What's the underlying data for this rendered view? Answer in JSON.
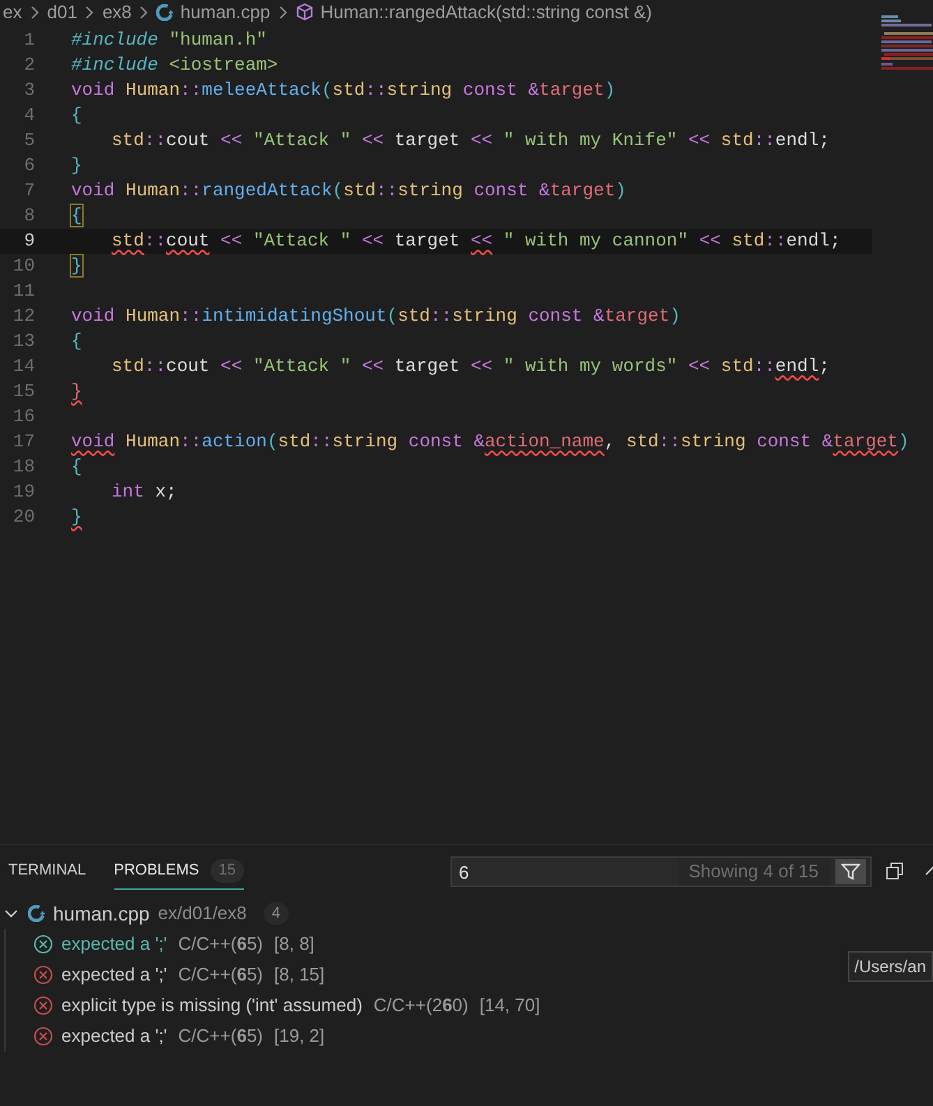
{
  "breadcrumb": [
    "ex",
    "d01",
    "ex8",
    "human.cpp",
    "Human::rangedAttack(std::string const &)"
  ],
  "code_lines": [
    {
      "number": "1",
      "active": false,
      "indented": false,
      "tokens": [
        {
          "kind": "directive",
          "text": "#include",
          "error": false
        },
        {
          "kind": "str",
          "text": " \"human.h\"",
          "error": false
        }
      ]
    },
    {
      "number": "2",
      "active": false,
      "indented": false,
      "tokens": [
        {
          "kind": "directive",
          "text": "#include",
          "error": false
        },
        {
          "kind": "str",
          "text": " <iostream>",
          "error": false
        }
      ]
    },
    {
      "number": "3",
      "active": false,
      "indented": false,
      "tokens": [
        {
          "kind": "kw",
          "text": "void ",
          "error": false
        },
        {
          "kind": "type",
          "text": "Human",
          "error": false
        },
        {
          "kind": "op",
          "text": "::",
          "error": false
        },
        {
          "kind": "fn",
          "text": "meleeAttack",
          "error": false
        },
        {
          "kind": "brace",
          "text": "(",
          "error": false
        },
        {
          "kind": "type",
          "text": "std",
          "error": false
        },
        {
          "kind": "op",
          "text": "::",
          "error": false
        },
        {
          "kind": "type",
          "text": "string ",
          "error": false
        },
        {
          "kind": "kw",
          "text": "const &",
          "error": false
        },
        {
          "kind": "param",
          "text": "target",
          "error": false
        },
        {
          "kind": "brace",
          "text": ")",
          "error": false
        }
      ]
    },
    {
      "number": "4",
      "active": false,
      "indented": false,
      "tokens": [
        {
          "kind": "brace",
          "text": "{",
          "error": false
        }
      ]
    },
    {
      "number": "5",
      "active": false,
      "indented": true,
      "tokens": [
        {
          "kind": "type",
          "text": "std",
          "error": false
        },
        {
          "kind": "op",
          "text": "::",
          "error": false
        },
        {
          "kind": "plain",
          "text": "cout ",
          "error": false
        },
        {
          "kind": "op",
          "text": "<< ",
          "error": false
        },
        {
          "kind": "str",
          "text": "\"Attack \" ",
          "error": false
        },
        {
          "kind": "op",
          "text": "<< ",
          "error": false
        },
        {
          "kind": "plain",
          "text": "target ",
          "error": false
        },
        {
          "kind": "op",
          "text": "<< ",
          "error": false
        },
        {
          "kind": "str",
          "text": "\" with my Knife\" ",
          "error": false
        },
        {
          "kind": "op",
          "text": "<< ",
          "error": false
        },
        {
          "kind": "type",
          "text": "std",
          "error": false
        },
        {
          "kind": "op",
          "text": "::",
          "error": false
        },
        {
          "kind": "plain",
          "text": "endl;",
          "error": false
        }
      ]
    },
    {
      "number": "6",
      "active": false,
      "indented": false,
      "tokens": [
        {
          "kind": "brace",
          "text": "}",
          "error": false
        }
      ]
    },
    {
      "number": "7",
      "active": false,
      "indented": false,
      "tokens": [
        {
          "kind": "kw",
          "text": "void ",
          "error": false
        },
        {
          "kind": "type",
          "text": "Human",
          "error": false
        },
        {
          "kind": "op",
          "text": "::",
          "error": false
        },
        {
          "kind": "fn",
          "text": "rangedAttack",
          "error": false
        },
        {
          "kind": "brace",
          "text": "(",
          "error": false
        },
        {
          "kind": "type",
          "text": "std",
          "error": false
        },
        {
          "kind": "op",
          "text": "::",
          "error": false
        },
        {
          "kind": "type",
          "text": "string ",
          "error": false
        },
        {
          "kind": "kw",
          "text": "const &",
          "error": false
        },
        {
          "kind": "param",
          "text": "target",
          "error": false
        },
        {
          "kind": "brace",
          "text": ")",
          "error": false
        }
      ]
    },
    {
      "number": "8",
      "active": false,
      "indented": false,
      "tokens": [
        {
          "kind": "match",
          "text": "{",
          "error": false
        }
      ]
    },
    {
      "number": "9",
      "active": true,
      "indented": true,
      "tokens": [
        {
          "kind": "type",
          "text": "std",
          "error": true
        },
        {
          "kind": "op",
          "text": "::",
          "error": false
        },
        {
          "kind": "plain",
          "text": "cout",
          "error": true
        },
        {
          "kind": "op",
          "text": " << ",
          "error": false
        },
        {
          "kind": "str",
          "text": "\"Attack \" ",
          "error": false
        },
        {
          "kind": "op",
          "text": "<< ",
          "error": false
        },
        {
          "kind": "plain",
          "text": "target ",
          "error": false
        },
        {
          "kind": "op",
          "text": "<<",
          "error": true
        },
        {
          "kind": "str",
          "text": " \" with my cannon\" ",
          "error": false
        },
        {
          "kind": "op",
          "text": "<< ",
          "error": false
        },
        {
          "kind": "type",
          "text": "std",
          "error": false
        },
        {
          "kind": "op",
          "text": "::",
          "error": false
        },
        {
          "kind": "plain",
          "text": "endl;",
          "error": false
        }
      ]
    },
    {
      "number": "10",
      "active": false,
      "indented": false,
      "tokens": [
        {
          "kind": "match",
          "text": "}",
          "error": false
        }
      ]
    },
    {
      "number": "11",
      "active": false
    },
    {
      "number": "12",
      "active": false,
      "indented": false,
      "tokens": [
        {
          "kind": "kw",
          "text": "void ",
          "error": false
        },
        {
          "kind": "type",
          "text": "Human",
          "error": false
        },
        {
          "kind": "op",
          "text": "::",
          "error": false
        },
        {
          "kind": "fn",
          "text": "intimidatingShout",
          "error": false
        },
        {
          "kind": "brace",
          "text": "(",
          "error": false
        },
        {
          "kind": "type",
          "text": "std",
          "error": false
        },
        {
          "kind": "op",
          "text": "::",
          "error": false
        },
        {
          "kind": "type",
          "text": "string ",
          "error": false
        },
        {
          "kind": "kw",
          "text": "const &",
          "error": false
        },
        {
          "kind": "param",
          "text": "target",
          "error": false
        },
        {
          "kind": "brace",
          "text": ")",
          "error": false
        }
      ]
    },
    {
      "number": "13",
      "active": false,
      "indented": false,
      "tokens": [
        {
          "kind": "brace",
          "text": "{",
          "error": false
        }
      ]
    },
    {
      "number": "14",
      "active": false,
      "indented": true,
      "tokens": [
        {
          "kind": "type",
          "text": "std",
          "error": false
        },
        {
          "kind": "op",
          "text": "::",
          "error": false
        },
        {
          "kind": "plain",
          "text": "cout ",
          "error": false
        },
        {
          "kind": "op",
          "text": "<< ",
          "error": false
        },
        {
          "kind": "str",
          "text": "\"Attack \" ",
          "error": false
        },
        {
          "kind": "op",
          "text": "<< ",
          "error": false
        },
        {
          "kind": "plain",
          "text": "target ",
          "error": false
        },
        {
          "kind": "op",
          "text": "<< ",
          "error": false
        },
        {
          "kind": "str",
          "text": "\" with my words\" ",
          "error": false
        },
        {
          "kind": "op",
          "text": "<< ",
          "error": false
        },
        {
          "kind": "type",
          "text": "std",
          "error": false
        },
        {
          "kind": "op",
          "text": "::",
          "error": false
        },
        {
          "kind": "plain",
          "text": "endl",
          "error": true
        },
        {
          "kind": "plain",
          "text": ";",
          "error": false
        }
      ]
    },
    {
      "number": "15",
      "active": false,
      "indented": false,
      "tokens": [
        {
          "kind": "param",
          "text": "}",
          "error": true
        }
      ]
    },
    {
      "number": "16",
      "active": false
    },
    {
      "number": "17",
      "active": false,
      "indented": false,
      "tokens": [
        {
          "kind": "kw",
          "text": "void",
          "error": true
        },
        {
          "kind": "type",
          "text": " Human",
          "error": false
        },
        {
          "kind": "op",
          "text": "::",
          "error": false
        },
        {
          "kind": "fn",
          "text": "action",
          "error": false
        },
        {
          "kind": "brace",
          "text": "(",
          "error": false
        },
        {
          "kind": "type",
          "text": "std",
          "error": false
        },
        {
          "kind": "op",
          "text": "::",
          "error": false
        },
        {
          "kind": "type",
          "text": "string ",
          "error": false
        },
        {
          "kind": "kw",
          "text": "const &",
          "error": false
        },
        {
          "kind": "param",
          "text": "action_name",
          "error": true
        },
        {
          "kind": "plain",
          "text": ", ",
          "error": false
        },
        {
          "kind": "type",
          "text": "std",
          "error": false
        },
        {
          "kind": "op",
          "text": "::",
          "error": false
        },
        {
          "kind": "type",
          "text": "string ",
          "error": false
        },
        {
          "kind": "kw",
          "text": "const &",
          "error": false
        },
        {
          "kind": "param",
          "text": "target",
          "error": true
        },
        {
          "kind": "brace",
          "text": ")",
          "error": false
        }
      ]
    },
    {
      "number": "18",
      "active": false,
      "indented": false,
      "tokens": [
        {
          "kind": "brace",
          "text": "{",
          "error": false
        }
      ]
    },
    {
      "number": "19",
      "active": false,
      "indented": true,
      "tokens": [
        {
          "kind": "kw",
          "text": "int ",
          "error": false
        },
        {
          "kind": "plain",
          "text": "x;",
          "error": false
        }
      ]
    },
    {
      "number": "20",
      "active": false,
      "indented": false,
      "tokens": [
        {
          "kind": "brace",
          "text": "}",
          "error": true
        }
      ]
    }
  ],
  "panel": {
    "tabs": [
      {
        "label": "TERMINAL",
        "selected": false
      },
      {
        "label": "PROBLEMS",
        "selected": true,
        "badge": "15"
      }
    ],
    "filter": {
      "value": "6",
      "status": "Showing 4 of 15"
    },
    "group": {
      "file": "human.cpp",
      "path": "ex/d01/ex8",
      "count": "4",
      "expanded": true
    },
    "problems": [
      {
        "message": "expected a ';'",
        "source": "C/C++(**6**5)",
        "position": "[8, 8]",
        "selected": true
      },
      {
        "message": "expected a ';'",
        "source": "C/C++(**6**5)",
        "position": "[8, 15]",
        "selected": false
      },
      {
        "message": "explicit type is missing ('int' assumed)",
        "source": "C/C++(2**6**0)",
        "position": "[14, 70]",
        "selected": false
      },
      {
        "message": "expected a ';'",
        "source": "C/C++(**6**5)",
        "position": "[19, 2]",
        "selected": false
      }
    ],
    "tooltip": "/Users/an"
  }
}
